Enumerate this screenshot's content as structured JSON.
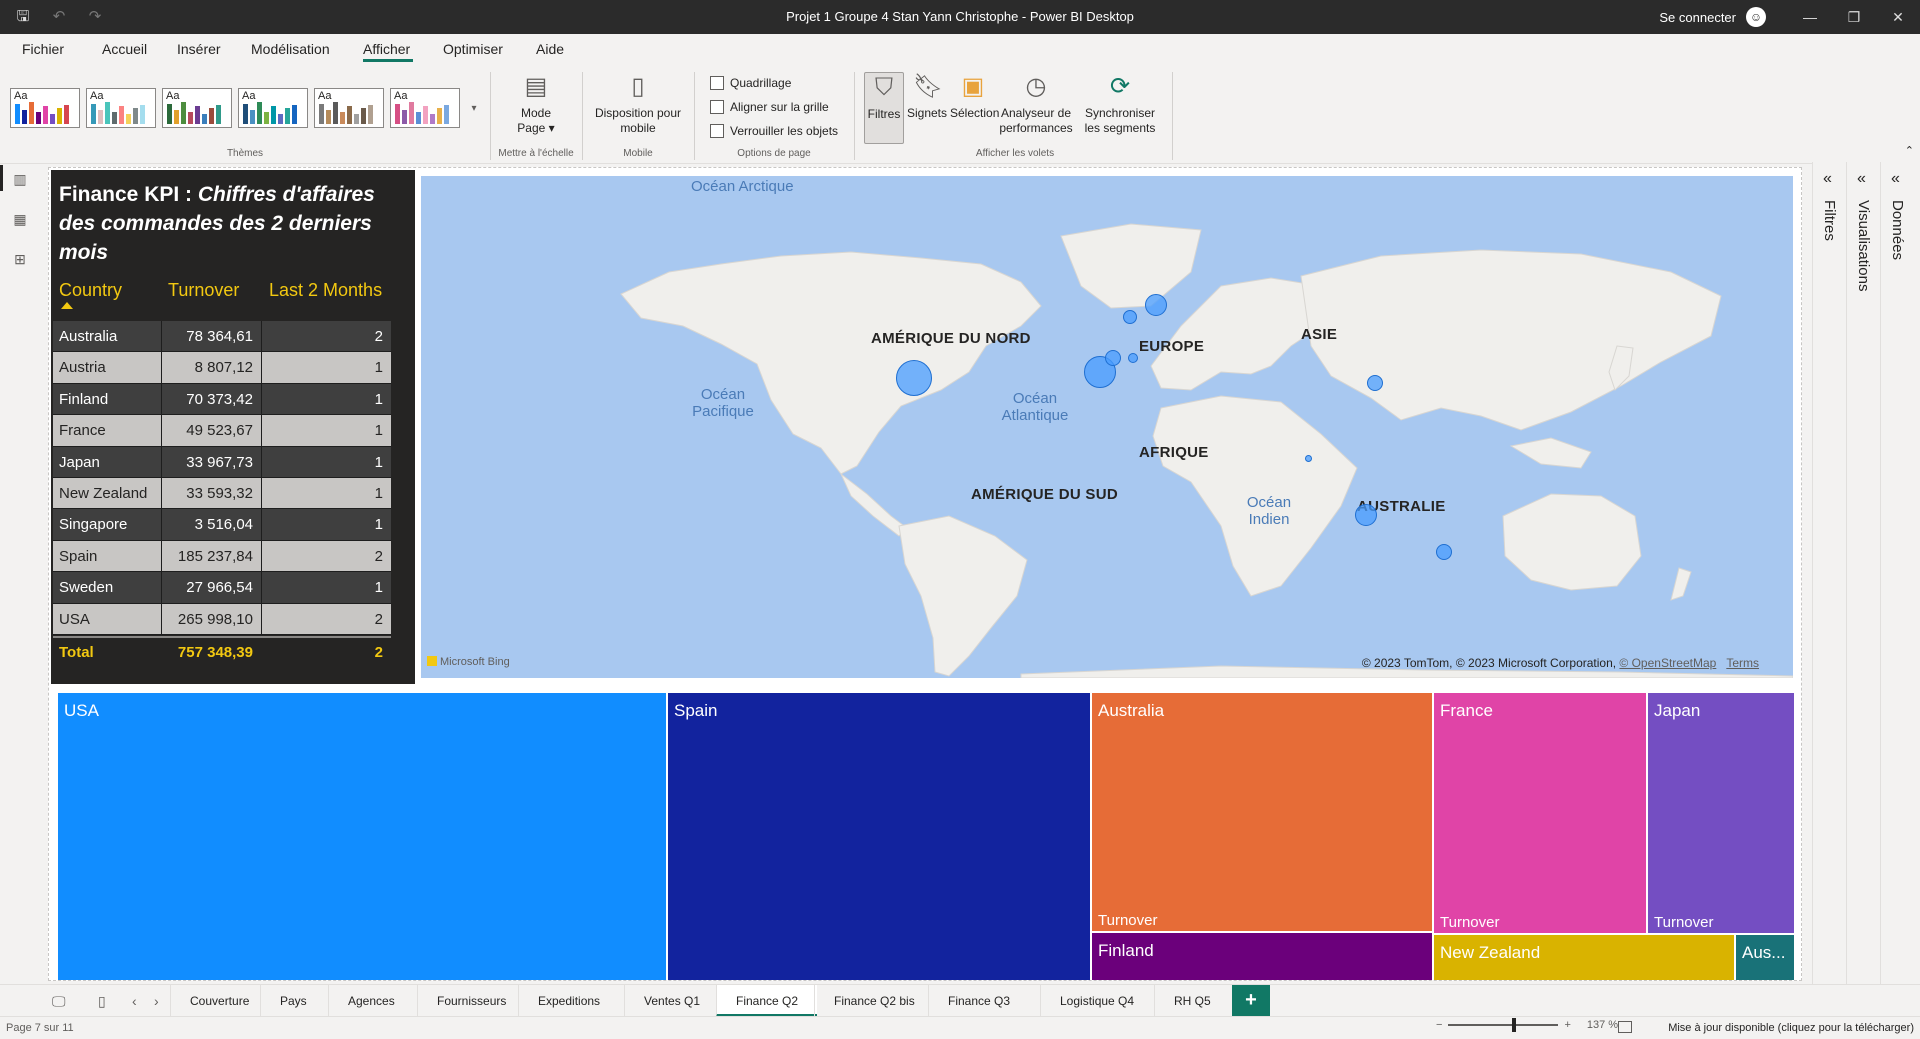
{
  "window": {
    "title": "Projet 1 Groupe 4 Stan Yann Christophe - Power BI Desktop",
    "signin": "Se connecter"
  },
  "menu": [
    "Fichier",
    "Accueil",
    "Insérer",
    "Modélisation",
    "Afficher",
    "Optimiser",
    "Aide"
  ],
  "menu_active": "Afficher",
  "ribbon": {
    "themes_label": "Thèmes",
    "theme_text": "Aa",
    "mode_page": "Mode Page",
    "scale_label": "Mettre à l'échelle",
    "mobile_btn": "Disposition pour mobile",
    "mobile_label": "Mobile",
    "checks": [
      "Quadrillage",
      "Aligner sur la grille",
      "Verrouiller les objets"
    ],
    "page_options_label": "Options de page",
    "panes": [
      "Filtres",
      "Signets",
      "Sélection",
      "Analyseur de performances",
      "Synchroniser les segments"
    ],
    "panes_label": "Afficher les volets"
  },
  "kpi": {
    "title_plain": "Finance KPI : ",
    "title_italic": "Chiffres d'affaires des commandes des 2 derniers mois",
    "headers": [
      "Country",
      "Turnover",
      "Last 2 Months"
    ],
    "rows": [
      {
        "country": "Australia",
        "turnover": "78 364,61",
        "months": "2"
      },
      {
        "country": "Austria",
        "turnover": "8 807,12",
        "months": "1"
      },
      {
        "country": "Finland",
        "turnover": "70 373,42",
        "months": "1"
      },
      {
        "country": "France",
        "turnover": "49 523,67",
        "months": "1"
      },
      {
        "country": "Japan",
        "turnover": "33 967,73",
        "months": "1"
      },
      {
        "country": "New Zealand",
        "turnover": "33 593,32",
        "months": "1"
      },
      {
        "country": "Singapore",
        "turnover": "3 516,04",
        "months": "1"
      },
      {
        "country": "Spain",
        "turnover": "185 237,84",
        "months": "2"
      },
      {
        "country": "Sweden",
        "turnover": "27 966,54",
        "months": "1"
      },
      {
        "country": "USA",
        "turnover": "265 998,10",
        "months": "2"
      }
    ],
    "total": {
      "label": "Total",
      "turnover": "757 348,39",
      "months": "2"
    }
  },
  "map": {
    "oceans": [
      "Océan Arctique",
      "Océan Pacifique",
      "Océan Atlantique",
      "Océan Indien"
    ],
    "continents": [
      "AMÉRIQUE DU NORD",
      "EUROPE",
      "ASIE",
      "AFRIQUE",
      "AMÉRIQUE DU SUD",
      "AUSTRALIE"
    ],
    "credit": "© 2023 TomTom, © 2023 Microsoft Corporation, ",
    "osm": "© OpenStreetMap",
    "terms": "Terms",
    "bing": "Microsoft Bing"
  },
  "treemap": {
    "usa": "USA",
    "spain": "Spain",
    "australia": "Australia",
    "france": "France",
    "japan": "Japan",
    "finland": "Finland",
    "newzealand": "New Zealand",
    "aus": "Aus...",
    "sublabel": "Turnover"
  },
  "colors": {
    "usa": "#118dff",
    "spain": "#12239e",
    "australia": "#e66c37",
    "france": "#e044a7",
    "japan": "#744ec2",
    "finland": "#6b007b",
    "newzealand": "#d9b300",
    "aus": "#197278",
    "accent": "#117865",
    "kpi_yellow": "#f2c811"
  },
  "right_panes": [
    "Filtres",
    "Visualisations",
    "Données"
  ],
  "pages": [
    "Couverture",
    "Pays",
    "Agences",
    "Fournisseurs",
    "Expeditions",
    "Ventes Q1",
    "Finance Q2",
    "Finance Q2 bis",
    "Finance Q3",
    "Logistique Q4",
    "RH Q5"
  ],
  "active_page": "Finance Q2",
  "status": {
    "page": "Page 7 sur 11",
    "zoom": "137 %",
    "update": "Mise à jour disponible (cliquez pour la télécharger)"
  }
}
